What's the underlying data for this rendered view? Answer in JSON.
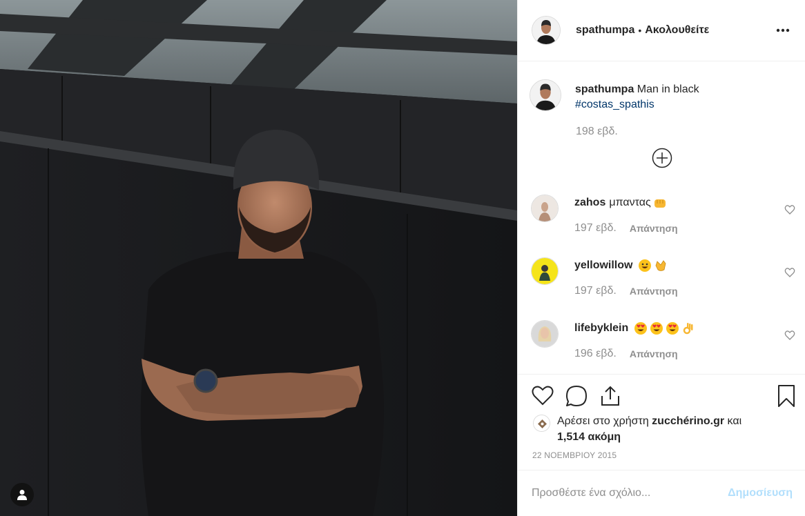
{
  "post": {
    "username": "spathumpa",
    "follow_label": "Ακολουθείτε",
    "caption_text": "Man in black",
    "hashtag": "#costas_spathis",
    "caption_time": "198 εβδ."
  },
  "comments": [
    {
      "user": "zahos",
      "text": "μπαντας",
      "emojis": [
        "fist-emoji"
      ],
      "time": "197 εβδ.",
      "reply": "Απάντηση"
    },
    {
      "user": "yellowillow",
      "text": "",
      "emojis": [
        "smile-emoji",
        "clap-emoji"
      ],
      "time": "197 εβδ.",
      "reply": "Απάντηση"
    },
    {
      "user": "lifebyklein",
      "text": "",
      "emojis": [
        "heart-eyes-emoji",
        "heart-eyes-emoji",
        "heart-eyes-emoji",
        "ok-hand-emoji"
      ],
      "time": "196 εβδ.",
      "reply": "Απάντηση"
    }
  ],
  "likes": {
    "prefix": "Αρέσει στο χρήστη",
    "user": "zucchérino.gr",
    "joiner": "και",
    "count": "1,514 ακόμη"
  },
  "date": "22 ΝΟΕΜΒΡΙΟΥ 2015",
  "add_comment": {
    "placeholder": "Προσθέστε ένα σχόλιο...",
    "post_label": "Δημοσίευση"
  },
  "colors": {
    "hashtag": "#003569",
    "muted": "#8e8e8e",
    "post_button": "#b2dffc"
  }
}
